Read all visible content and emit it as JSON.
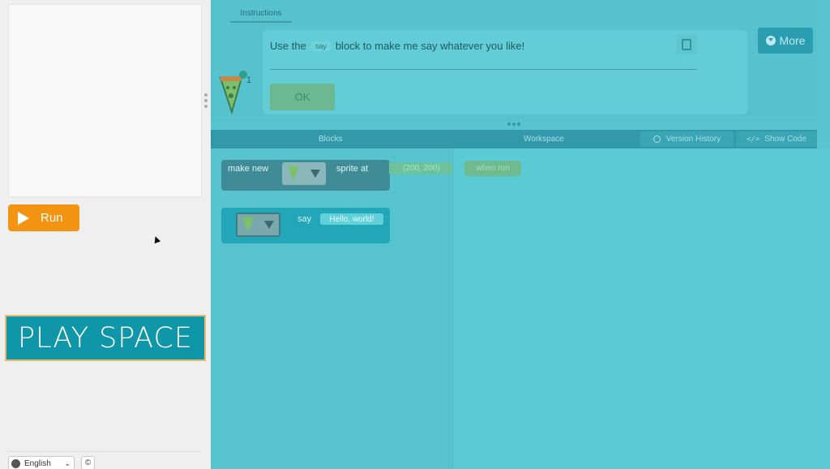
{
  "left": {
    "run_label": "Run",
    "play_space_label": "PLAY SPACE",
    "language": "English",
    "copyright_symbol": "©"
  },
  "instructions": {
    "tab_label": "Instructions",
    "text_before": "Use the",
    "say_chip": "say",
    "text_after": "block to make me say whatever you like!",
    "ok_label": "OK",
    "badge_number": "1",
    "more_label": "More"
  },
  "header": {
    "blocks_label": "Blocks",
    "workspace_label": "Workspace",
    "version_history_label": "Version History",
    "show_code_label": "Show Code"
  },
  "toolbox": {
    "make_new_label": "make new",
    "sprite_at_label": "sprite at",
    "coord_value": "(200, 200)",
    "say_label": "say",
    "say_value": "Hello, world!"
  },
  "workspace": {
    "when_run_label": "when run"
  },
  "colors": {
    "accent_teal": "#57c4cf",
    "run_orange": "#f29412",
    "play_space_teal": "#0f96a8",
    "header_blue": "#3299ab"
  }
}
